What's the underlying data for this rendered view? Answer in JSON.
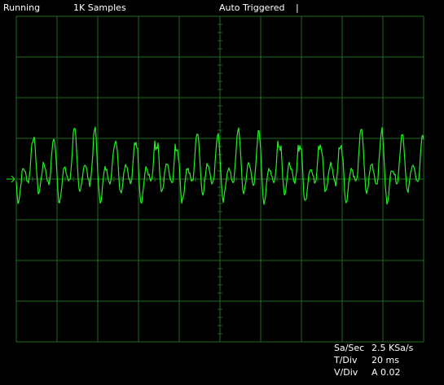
{
  "status": {
    "run_state": "Running",
    "samples": "1K Samples",
    "trigger": "Auto Triggered",
    "trigger_marker": "|"
  },
  "scope": {
    "grid_color": "#1f6b1f",
    "trace_color": "#22ee22",
    "marker_color": "#22ee22",
    "channel_marker_icon": "right-arrow"
  },
  "readout": {
    "sa_sec_label": "Sa/Sec",
    "sa_sec_value": "2.5 KSa/s",
    "t_div_label": "T/Div",
    "t_div_value": "20 ms",
    "v_div_label": "V/Div",
    "v_div_value": "A 0.02"
  },
  "waveform": {
    "peaks": [
      [
        0.95,
        0.7
      ],
      [
        -0.6,
        0.45
      ],
      [
        0.15,
        0.35
      ],
      [
        -0.15,
        0.3
      ],
      [
        1.0,
        0.7
      ],
      [
        -0.4,
        0.35
      ],
      [
        0.25,
        0.3
      ],
      [
        -0.2,
        0.25
      ]
    ],
    "jitter": 0.06
  }
}
